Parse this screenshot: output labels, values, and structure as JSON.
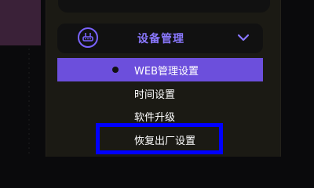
{
  "menu": {
    "header_label": "设备管理",
    "header_icon": "router-icon",
    "expand_icon": "chevron-down-icon",
    "items": [
      {
        "label": "WEB管理设置",
        "active": true
      },
      {
        "label": "时间设置",
        "active": false
      },
      {
        "label": "软件升级",
        "active": false
      },
      {
        "label": "恢复出厂设置",
        "active": false,
        "highlighted": true
      }
    ]
  },
  "colors": {
    "accent": "#6c4fdc",
    "header_text": "#8a78ff",
    "highlight_border": "#0000ff",
    "panel_bg": "#1b1a14",
    "page_bg": "#0a0a0c"
  }
}
